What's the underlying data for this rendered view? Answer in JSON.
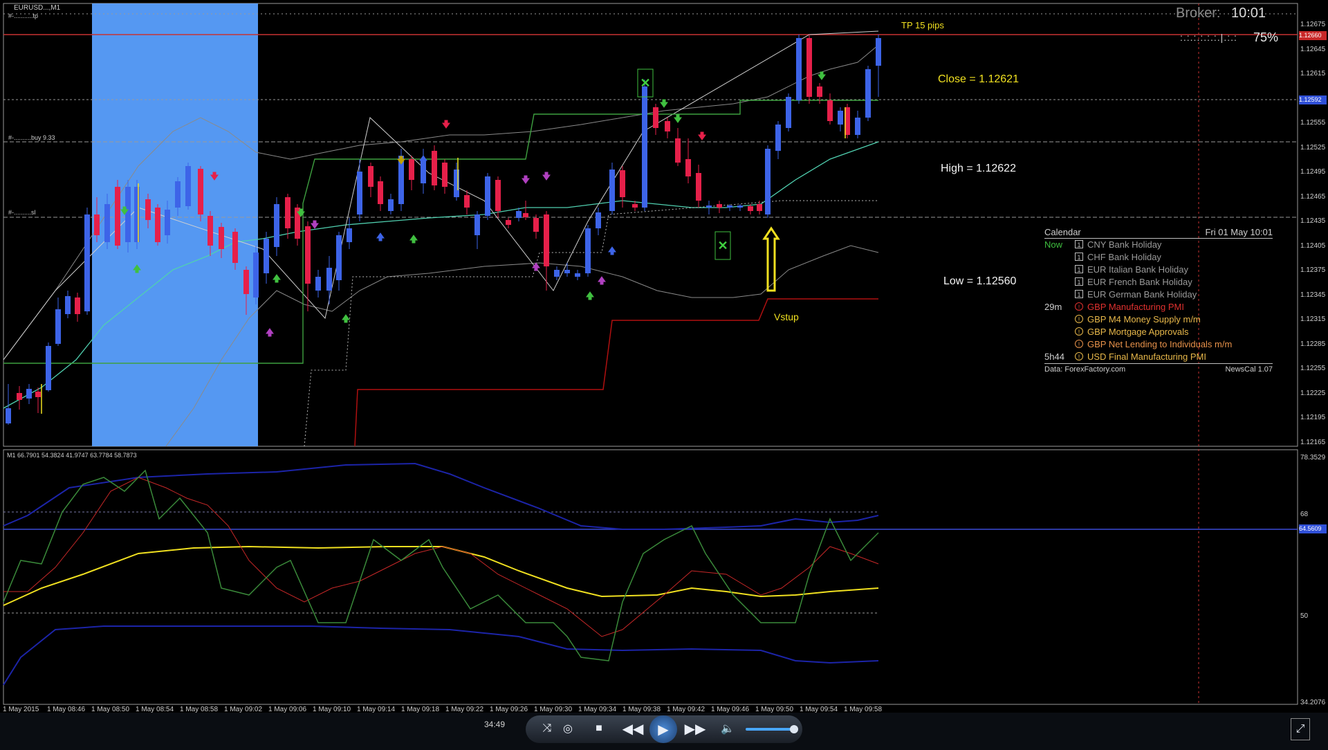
{
  "chart": {
    "symbol": "EURUSD...,M1",
    "broker_label": "Broker:",
    "broker_time": "10:01",
    "progress_percent": "75%",
    "tp_label": "TP 15 pips",
    "close_label": "Close = 1.12621",
    "high_label": "High = 1.12622",
    "low_label": "Low = 1.12560",
    "vstup_label": "Vstup",
    "line_tp": "#-...........tp",
    "line_buy": "#-..........buy 9.33",
    "line_sl": "#-..........sl",
    "price_ticks": [
      "1.12675",
      "1.12645",
      "1.12615",
      "1.12585",
      "1.12555",
      "1.12525",
      "1.12495",
      "1.12465",
      "1.12435",
      "1.12405",
      "1.12375",
      "1.12345",
      "1.12315",
      "1.12285",
      "1.12255",
      "1.12225",
      "1.12195",
      "1.12165"
    ],
    "price_tag_red": "1.12660",
    "price_tag_blue": "1.12592",
    "time_ticks": [
      "1 May 2015",
      "1 May 08:46",
      "1 May 08:50",
      "1 May 08:54",
      "1 May 08:58",
      "1 May 09:02",
      "1 May 09:06",
      "1 May 09:10",
      "1 May 09:14",
      "1 May 09:18",
      "1 May 09:22",
      "1 May 09:26",
      "1 May 09:30",
      "1 May 09:34",
      "1 May 09:38",
      "1 May 09:42",
      "1 May 09:46",
      "1 May 09:50",
      "1 May 09:54",
      "1 May 09:58"
    ]
  },
  "indicator": {
    "label": "M1  66.7901 54.3824 41.9747 63.7784 58.7873",
    "ticks": [
      "78.3529",
      "68",
      "50",
      "34.2076"
    ],
    "tag_value": "64.5609"
  },
  "calendar": {
    "title": "Calendar",
    "datetime": "Fri 01 May 10:01",
    "rows": [
      {
        "when": "Now",
        "icon": "1",
        "event": "CNY  Bank Holiday",
        "color": "#9a9a9a",
        "when_color": "#3fbf3f"
      },
      {
        "when": "",
        "icon": "1",
        "event": "CHF  Bank Holiday",
        "color": "#9a9a9a",
        "when_color": "#3fbf3f"
      },
      {
        "when": "",
        "icon": "1",
        "event": "EUR  Italian Bank Holiday",
        "color": "#9a9a9a",
        "when_color": "#3fbf3f"
      },
      {
        "when": "",
        "icon": "1",
        "event": "EUR  French Bank Holiday",
        "color": "#9a9a9a",
        "when_color": "#3fbf3f"
      },
      {
        "when": "",
        "icon": "1",
        "event": "EUR  German Bank Holiday",
        "color": "#9a9a9a",
        "when_color": "#3fbf3f"
      },
      {
        "when": "29m",
        "icon": "!",
        "event": "GBP  Manufacturing PMI",
        "color": "#e0312f",
        "when_color": "#cfcfcf"
      },
      {
        "when": "",
        "icon": "!",
        "event": "GBP  M4 Money Supply m/m",
        "color": "#e8b84a",
        "when_color": "#cfcfcf"
      },
      {
        "when": "",
        "icon": "!",
        "event": "GBP  Mortgage Approvals",
        "color": "#e8b84a",
        "when_color": "#cfcfcf"
      },
      {
        "when": "",
        "icon": "!",
        "event": "GBP  Net Lending to Individuals m/m",
        "color": "#e8924a",
        "when_color": "#cfcfcf"
      },
      {
        "when": "5h44",
        "icon": "!",
        "event": "USD  Final Manufacturing PMI",
        "color": "#e8b84a",
        "when_color": "#cfcfcf"
      }
    ],
    "footer_left": "Data: ForexFactory.com",
    "footer_right": "NewsCal 1.07"
  },
  "player": {
    "time": "34:49",
    "icons": [
      "switch-icon",
      "reload-icon",
      "stop-icon",
      "rewind-icon",
      "play-icon",
      "fast-forward-icon",
      "volume-icon",
      "volume-slider",
      "fullscreen-icon"
    ]
  },
  "colors": {
    "bull": "#3d64e8",
    "bear": "#e6204a",
    "highlight": "#5aa0ff",
    "tp_line": "#c83232",
    "yellow": "#f0e020"
  }
}
